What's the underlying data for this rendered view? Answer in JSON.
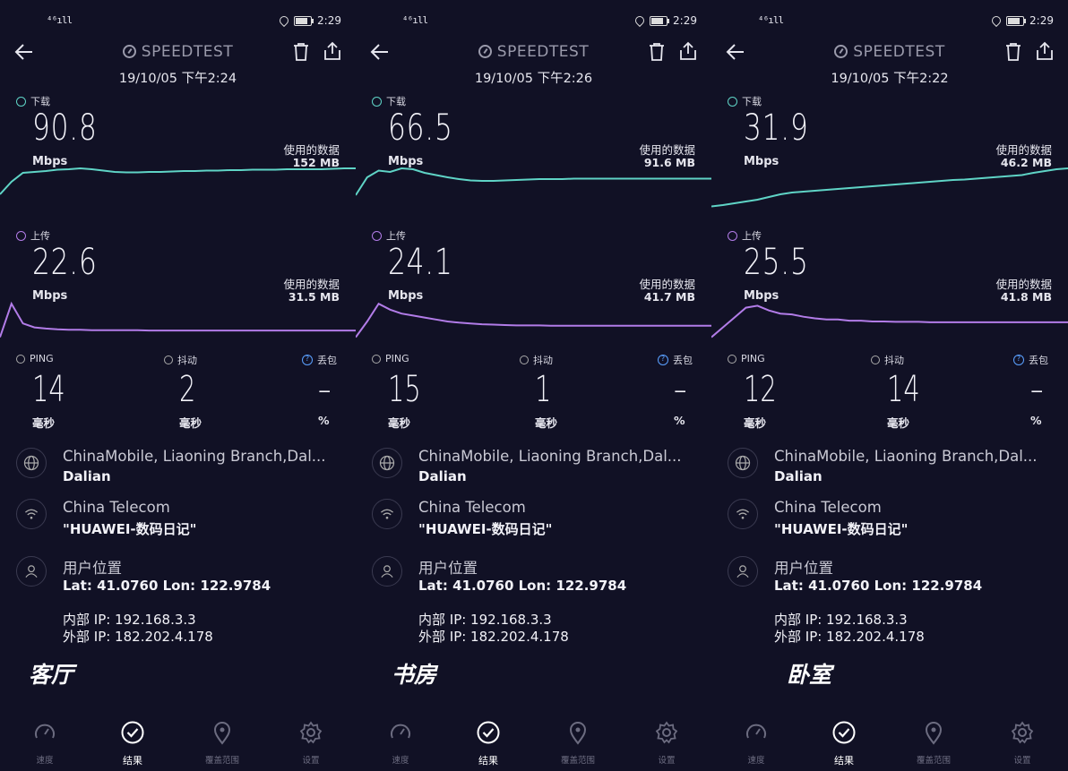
{
  "status": {
    "signal": "⁴⁶ıll",
    "time": "2:29"
  },
  "app": {
    "brand": "SPEEDTEST"
  },
  "labels": {
    "download": "下载",
    "upload": "上传",
    "unit": "Mbps",
    "used": "使用的数据",
    "ping": "PING",
    "jitter": "抖动",
    "loss": "丢包",
    "ms": "毫秒",
    "pct": "%",
    "isp_line1": "ChinaMobile, Liaoning Branch,Dal...",
    "isp_line2": "Dalian",
    "wifi_line1": "China Telecom",
    "wifi_line2": "\"HUAWEI-数码日记\"",
    "loc_line1": "用户位置",
    "loc_line2": "Lat: 41.0760 Lon: 122.9784",
    "internal_ip": "内部 IP: 192.168.3.3",
    "external_ip": "外部 IP: 182.202.4.178"
  },
  "nav": {
    "speed": "速度",
    "results": "结果",
    "coverage": "覆盖范围",
    "settings": "设置"
  },
  "colors": {
    "download": "#5fd4c6",
    "upload": "#b27ce8",
    "background": "#111125"
  },
  "screens": [
    {
      "date": "19/10/05 下午2:24",
      "download": "90.8",
      "download_used": "152 MB",
      "upload": "22.6",
      "upload_used": "31.5 MB",
      "ping": "14",
      "jitter": "2",
      "loss": "–",
      "room": "客厅",
      "download_curve": [
        0.32,
        0.6,
        0.8,
        0.82,
        0.84,
        0.87,
        0.88,
        0.9,
        0.88,
        0.85,
        0.82,
        0.81,
        0.81,
        0.82,
        0.82,
        0.83,
        0.84,
        0.84,
        0.85,
        0.85,
        0.86,
        0.86,
        0.87,
        0.87,
        0.87,
        0.88,
        0.88,
        0.88,
        0.88,
        0.89,
        0.9,
        0.9
      ],
      "upload_curve": [
        0.1,
        0.95,
        0.45,
        0.35,
        0.32,
        0.3,
        0.29,
        0.29,
        0.28,
        0.28,
        0.28,
        0.28,
        0.28,
        0.27,
        0.27,
        0.27,
        0.27,
        0.27,
        0.27,
        0.27,
        0.27,
        0.27,
        0.27,
        0.27,
        0.27,
        0.27,
        0.27,
        0.27,
        0.27,
        0.27,
        0.27,
        0.27
      ]
    },
    {
      "date": "19/10/05 下午2:26",
      "download": "66.5",
      "download_used": "91.6 MB",
      "upload": "24.1",
      "upload_used": "41.7 MB",
      "ping": "15",
      "jitter": "1",
      "loss": "–",
      "room": "书房",
      "download_curve": [
        0.3,
        0.7,
        0.85,
        0.82,
        0.9,
        0.88,
        0.8,
        0.75,
        0.7,
        0.66,
        0.63,
        0.62,
        0.62,
        0.63,
        0.64,
        0.65,
        0.66,
        0.66,
        0.66,
        0.67,
        0.67,
        0.67,
        0.67,
        0.67,
        0.67,
        0.67,
        0.67,
        0.67,
        0.67,
        0.67,
        0.67,
        0.67
      ],
      "upload_curve": [
        0.1,
        0.5,
        0.95,
        0.8,
        0.7,
        0.65,
        0.6,
        0.55,
        0.5,
        0.47,
        0.45,
        0.43,
        0.42,
        0.41,
        0.4,
        0.4,
        0.4,
        0.39,
        0.39,
        0.39,
        0.39,
        0.39,
        0.39,
        0.39,
        0.39,
        0.39,
        0.39,
        0.39,
        0.39,
        0.39,
        0.39,
        0.39
      ]
    },
    {
      "date": "19/10/05 下午2:22",
      "download": "31.9",
      "download_used": "46.2 MB",
      "upload": "25.5",
      "upload_used": "41.8 MB",
      "ping": "12",
      "jitter": "14",
      "loss": "–",
      "room": "卧室",
      "download_curve": [
        0.05,
        0.08,
        0.12,
        0.16,
        0.2,
        0.26,
        0.32,
        0.36,
        0.38,
        0.4,
        0.42,
        0.44,
        0.46,
        0.48,
        0.5,
        0.52,
        0.54,
        0.56,
        0.58,
        0.6,
        0.62,
        0.64,
        0.65,
        0.67,
        0.69,
        0.71,
        0.73,
        0.75,
        0.8,
        0.84,
        0.88,
        0.9
      ],
      "upload_curve": [
        0.1,
        0.35,
        0.6,
        0.85,
        0.9,
        0.78,
        0.7,
        0.68,
        0.62,
        0.58,
        0.55,
        0.55,
        0.52,
        0.52,
        0.5,
        0.5,
        0.49,
        0.49,
        0.49,
        0.48,
        0.48,
        0.48,
        0.48,
        0.48,
        0.48,
        0.48,
        0.48,
        0.48,
        0.48,
        0.48,
        0.48,
        0.48
      ]
    }
  ]
}
